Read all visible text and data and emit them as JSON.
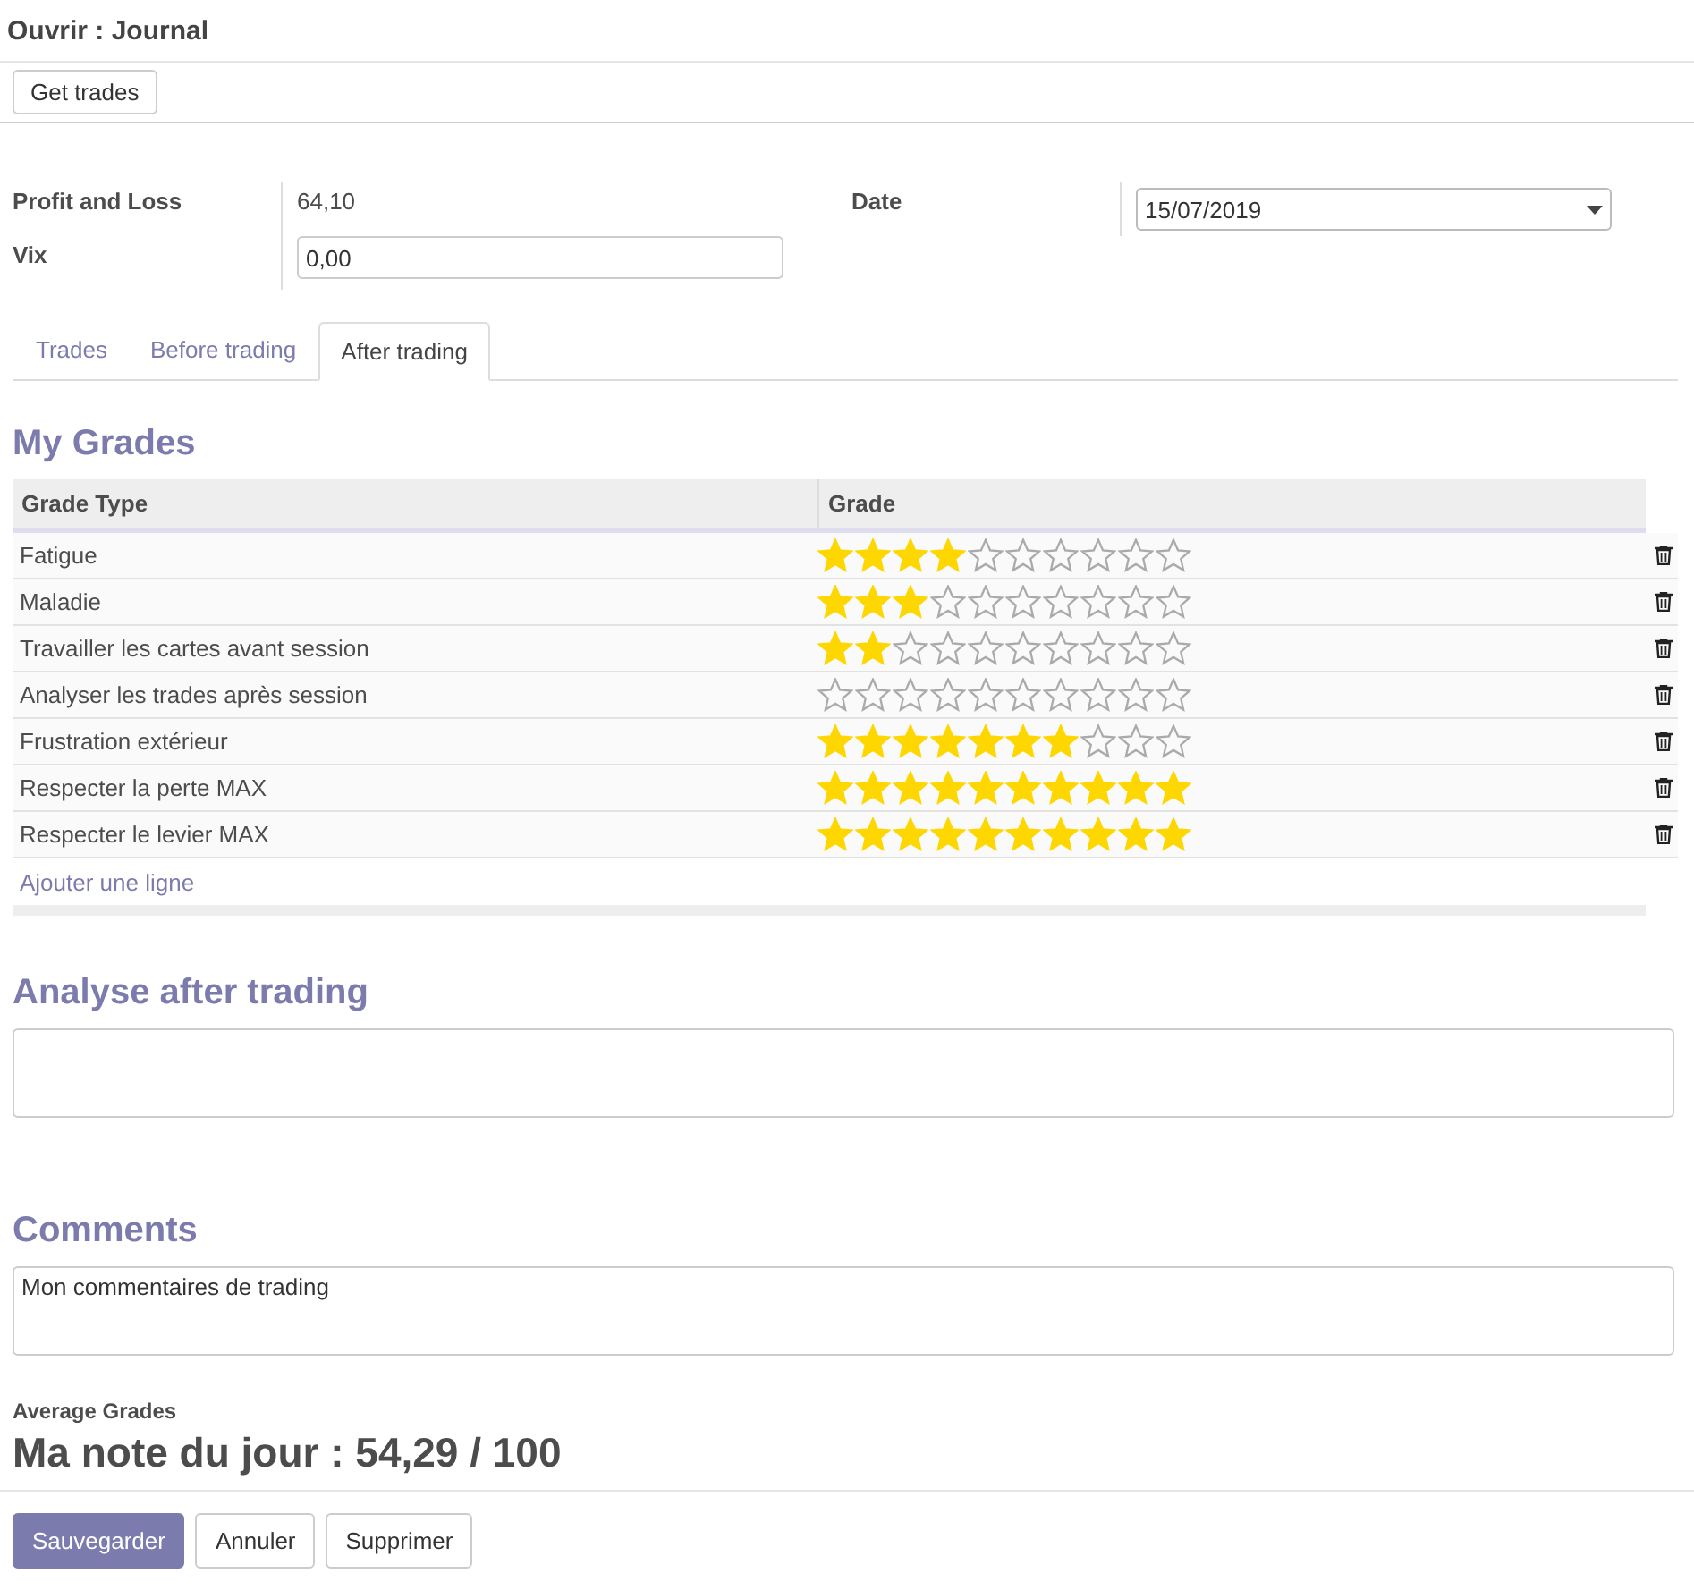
{
  "window": {
    "title": "Ouvrir : Journal"
  },
  "toolbar": {
    "buttons": [
      "Get trades"
    ]
  },
  "fields": {
    "profit_label": "Profit and Loss",
    "profit_value": "64,10",
    "vix_label": "Vix",
    "vix_value": "0,00",
    "date_label": "Date",
    "date_value": "15/07/2019"
  },
  "tabs": [
    {
      "label": "Trades",
      "selected": false
    },
    {
      "label": "Before trading",
      "selected": false
    },
    {
      "label": "After trading",
      "selected": true
    }
  ],
  "grades": {
    "title": "My Grades",
    "columns": [
      "Grade Type",
      "Grade"
    ],
    "rows": [
      {
        "name": "Fatigue",
        "stars": 4
      },
      {
        "name": "Maladie",
        "stars": 3
      },
      {
        "name": "Travailler les cartes avant session",
        "stars": 2
      },
      {
        "name": "Analyser les trades après session",
        "stars": 0
      },
      {
        "name": "Frustration extérieur",
        "stars": 7
      },
      {
        "name": "Respecter la perte MAX",
        "stars": 10
      },
      {
        "name": "Respecter le levier MAX",
        "stars": 10
      }
    ],
    "add_line": "Ajouter une ligne"
  },
  "analyse": {
    "title": "Analyse after trading"
  },
  "comments": {
    "title": "Comments",
    "value": "Mon commentaires de trading"
  },
  "average": {
    "label": "Average Grades",
    "value": "Ma note du jour : 54,29 / 100"
  },
  "footer": {
    "buttons": [
      {
        "label": "Sauvegarder",
        "kind": "primary"
      },
      {
        "label": "Annuler",
        "kind": "default"
      },
      {
        "label": "Supprimer",
        "kind": "default"
      }
    ]
  }
}
